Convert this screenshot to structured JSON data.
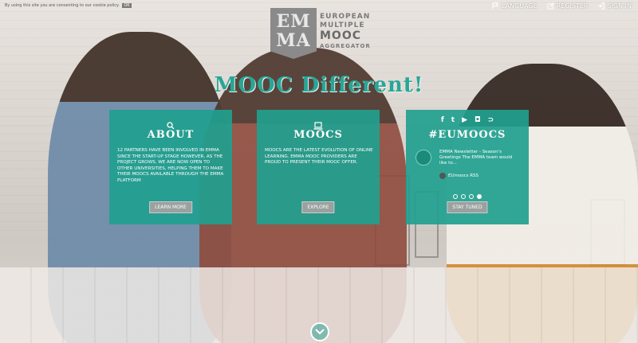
{
  "cookie": {
    "text": "By using this site you are consenting to our cookie policy.",
    "ok": "OK"
  },
  "topnav": [
    {
      "label": "LANGUAGE",
      "icon": "flag-icon"
    },
    {
      "label": "REGISTER",
      "icon": "edit-icon"
    },
    {
      "label": "SIGN IN",
      "icon": "signin-icon"
    }
  ],
  "logo": {
    "badge_line1": "EM",
    "badge_line2": "MA",
    "word1": "EUROPEAN",
    "word2": "MULTIPLE",
    "word3": "MOOC",
    "word4": "AGGREGATOR"
  },
  "headline": "MOOC Different!",
  "panels": {
    "about": {
      "icon": "search-icon",
      "title": "ABOUT",
      "text": "12 partners have been involved in EMMA since the start-up stage however, as the project grows, we are now open to other universities, helping them to make their moocs available through the EMMA platform",
      "button": "LEARN MORE"
    },
    "moocs": {
      "icon": "laptop-icon",
      "title": "MOOCS",
      "text": "MOOCs are the latest evolution of online learning. EMMA MOOC providers are proud to present their MOOC offer.",
      "button": "EXPLORE"
    },
    "eumoocs": {
      "title": "#EUMOOCS",
      "social": [
        "f",
        "t",
        "▶",
        "◘",
        "⊃"
      ],
      "tweet_text": "EMMA Newsletter - Season's Greetings The EMMA team would like to...",
      "rss": "EUmoocs RSS",
      "button": "STAY TUNED"
    }
  },
  "colors": {
    "accent": "#21a08f",
    "headline": "#2aa596",
    "button": "#9aa19f"
  }
}
